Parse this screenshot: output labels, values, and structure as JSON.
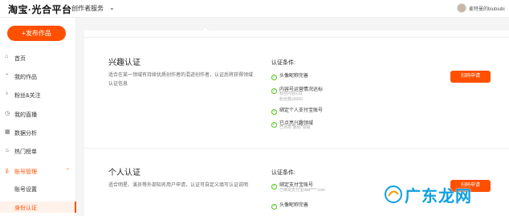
{
  "header": {
    "logo": "淘宝·光合平台",
    "service_menu": "创作者服务",
    "username": "麦特曼的biubiubi"
  },
  "sidebar": {
    "publish_label": "+发布作品",
    "items": [
      {
        "label": "首页",
        "icon": "home-icon",
        "glyph": "⌂"
      },
      {
        "label": "我的作品",
        "icon": "works-icon",
        "glyph": "◔"
      },
      {
        "label": "粉丝&关注",
        "icon": "fans-icon",
        "glyph": "♁"
      },
      {
        "label": "我的直播",
        "icon": "live-icon",
        "glyph": "◷"
      },
      {
        "label": "数据分析",
        "icon": "chart-icon",
        "glyph": "▦"
      },
      {
        "label": "热门榜单",
        "icon": "hot-icon",
        "glyph": "♨"
      },
      {
        "label": "账号管理",
        "icon": "account-icon",
        "glyph": "ꆜ"
      }
    ],
    "sub_items": [
      {
        "label": "账号设置"
      },
      {
        "label": "身份认证"
      }
    ]
  },
  "cards": [
    {
      "title": "兴趣认证",
      "desc": "适合在某一领域有持续优质创作者的混迹创作者，认证后将获得领域认证信息",
      "cond_title": "认证条件:",
      "conditions": [
        {
          "text": "头像昵称完善",
          "sub": ""
        },
        {
          "text": "内容号运营情况达标",
          "sub": "粉丝内容≥10\n粉丝数≥5000"
        },
        {
          "text": "绑定个人支付宝账号",
          "sub": ""
        },
        {
          "text": "已点亮兴趣领域",
          "sub": "已点亮\"数码\"领域"
        }
      ],
      "button": "扫码申请"
    },
    {
      "title": "个人认证",
      "desc": "适合明星、演员等外部知名用户申请，认证可自定义填写认证说明",
      "cond_title": "认证条件:",
      "conditions": [
        {
          "text": "绑定支付宝账号",
          "sub": "已绑定支付宝ddd****.com"
        },
        {
          "text": "头像昵称完善",
          "sub": ""
        }
      ],
      "button": "扫码申请"
    }
  ],
  "watermark": "广东龙网",
  "colors": {
    "accent": "#ff5000",
    "ok": "#52c41a",
    "watermark": "#0ea0e0"
  }
}
